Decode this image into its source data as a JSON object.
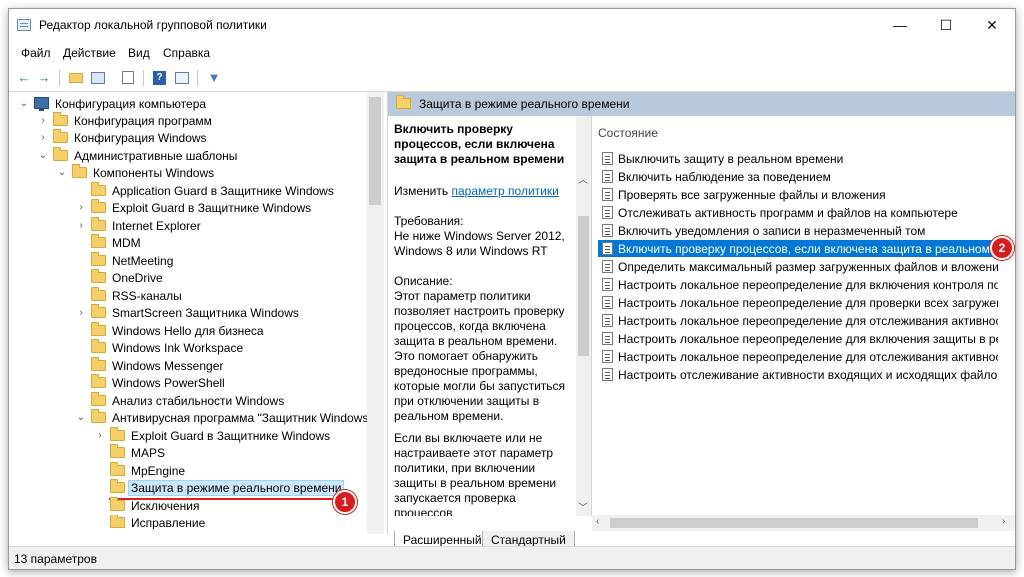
{
  "window": {
    "title": "Редактор локальной групповой политики",
    "minimize": "—",
    "maximize": "☐",
    "close": "✕"
  },
  "menu": [
    "Файл",
    "Действие",
    "Вид",
    "Справка"
  ],
  "toolbar": {
    "back": "←",
    "forward": "→",
    "filter": "▼"
  },
  "tree": {
    "root": "Конфигурация компьютера",
    "items": [
      "Конфигурация программ",
      "Конфигурация Windows",
      "Административные шаблоны",
      "Компоненты Windows",
      "Application Guard в Защитнике Windows",
      "Exploit Guard в Защитнике Windows",
      "Internet Explorer",
      "MDM",
      "NetMeeting",
      "OneDrive",
      "RSS-каналы",
      "SmartScreen Защитника Windows",
      "Windows Hello для бизнеса",
      "Windows Ink Workspace",
      "Windows Messenger",
      "Windows PowerShell",
      "Анализ стабильности Windows",
      "Антивирусная программа \"Защитник Windows\"",
      "Exploit Guard в Защитнике Windows",
      "MAPS",
      "MpEngine",
      "Защита в режиме реального времени",
      "Исключения",
      "Исправление"
    ]
  },
  "right": {
    "header": "Защита в режиме реального времени",
    "desc_title": "Включить проверку процессов, если включена защита в реальном времени",
    "edit_prefix": "Изменить",
    "edit_link": "параметр политики",
    "requirements_label": "Требования:",
    "requirements_text": "Не ниже Windows Server 2012, Windows 8 или Windows RT",
    "description_label": "Описание:",
    "description_text": "Этот параметр политики позволяет настроить проверку процессов, когда включена защита в реальном времени. Это помогает обнаружить вредоносные программы, которые могли бы запуститься при отключении защиты в реальном времени.",
    "description_text2": "Если вы включаете или не настраиваете этот параметр политики, при включении защиты в реальном времени запускается проверка процессов.",
    "column_header": "Состояние",
    "policies": [
      "Выключить защиту в реальном времени",
      "Включить наблюдение за поведением",
      "Проверять все загруженные файлы и вложения",
      "Отслеживать активность программ и файлов на компьютере",
      "Включить уведомления о записи в неразмеченный том",
      "Включить проверку процессов, если включена защита в реальном вре...",
      "Определить максимальный размер загруженных файлов и вложений дл...",
      "Настроить локальное переопределение для включения контроля поведе...",
      "Настроить локальное переопределение для проверки всех загруженны...",
      "Настроить локальное переопределение для отслеживания активности ...",
      "Настроить локальное переопределение для включения защиты в реаль...",
      "Настроить локальное переопределение для отслеживания активности в...",
      "Настроить отслеживание активности входящих и исходящих файлов и п..."
    ],
    "tabs": [
      "Расширенный",
      "Стандартный"
    ]
  },
  "callouts": [
    "1",
    "2"
  ],
  "status": "13 параметров",
  "colors": {
    "selection": "#0078d7",
    "header_band": "#b9c9dc",
    "callout": "#d71d1d"
  }
}
